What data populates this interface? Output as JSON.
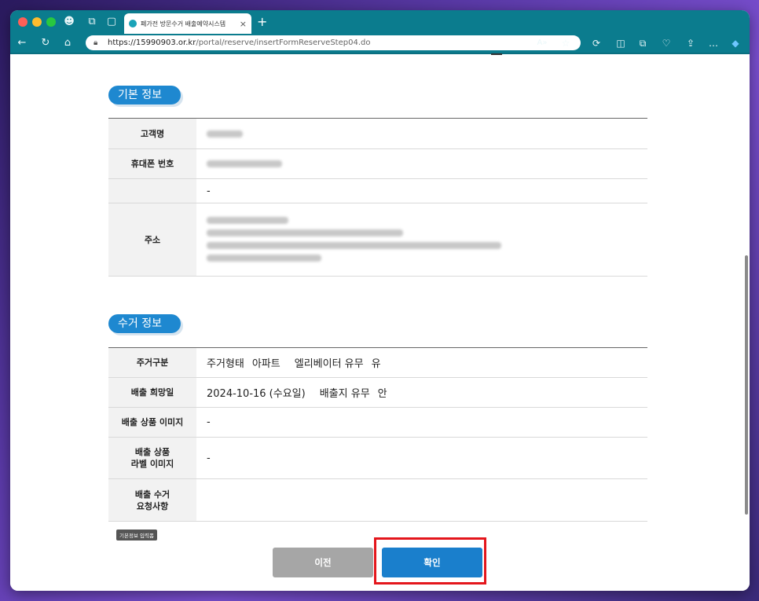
{
  "browser": {
    "tab_title": "폐가전 방문수거 배출예약시스템",
    "url_base": "https://15990903.or.kr",
    "url_path": "/portal/reserve/insertFormReserveStep04.do"
  },
  "sections": {
    "basic": {
      "title": "기본 정보",
      "rows": {
        "name_label": "고객명",
        "phone_label": "휴대폰 번호",
        "extra_value": "-",
        "address_label": "주소"
      }
    },
    "pickup": {
      "title": "수거 정보",
      "rows": {
        "type_label": "주거구분",
        "housing_type_label": "주거형태",
        "housing_type_value": "아파트",
        "elevator_label": "엘리베이터 유무",
        "elevator_value": "유",
        "date_label": "배출 희망일",
        "date_value": "2024-10-16 (수요일)",
        "dispose_label": "배출지 유무",
        "dispose_value": "안",
        "image_label": "배출 상품 이미지",
        "image_value": "-",
        "label_image_label_1": "배출 상품",
        "label_image_label_2": "라벨 이미지",
        "label_image_value": "-",
        "request_label_1": "배출 수거",
        "request_label_2": "요청사항",
        "request_value": ""
      }
    }
  },
  "tooltip": "기본정보 입력폼",
  "buttons": {
    "prev": "이전",
    "confirm": "확인"
  },
  "colors": {
    "browser_chrome": "#0b7c8e",
    "section_pill": "#1e88d0",
    "confirm_button": "#1a7fcc",
    "prev_button": "#a6a6a6",
    "highlight_box": "#e4161c"
  }
}
